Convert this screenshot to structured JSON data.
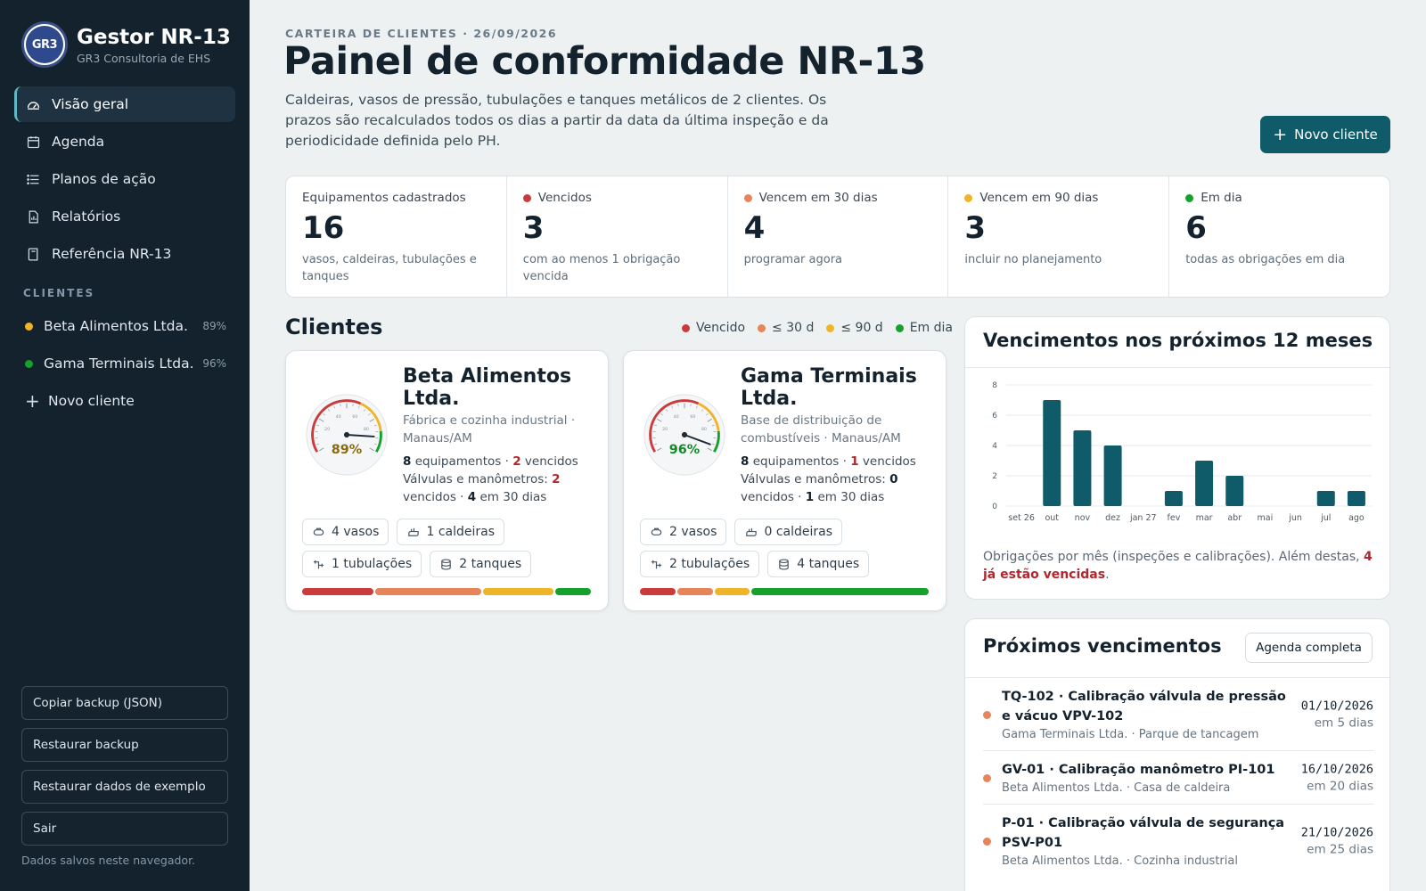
{
  "brand": {
    "title": "Gestor NR-13",
    "subtitle": "GR3 Consultoria de EHS",
    "logo_text": "GR3"
  },
  "nav": [
    {
      "label": "Visão geral",
      "icon": "gauge-icon",
      "active": true
    },
    {
      "label": "Agenda",
      "icon": "calendar-icon"
    },
    {
      "label": "Planos de ação",
      "icon": "list-icon"
    },
    {
      "label": "Relatórios",
      "icon": "report-icon"
    },
    {
      "label": "Referência NR-13",
      "icon": "book-icon"
    }
  ],
  "clients_section_label": "CLIENTES",
  "sidebar_clients": [
    {
      "name": "Beta Alimentos Ltda.",
      "pct": "89%",
      "color": "#f0b429"
    },
    {
      "name": "Gama Terminais Ltda.",
      "pct": "96%",
      "color": "#16a02c"
    }
  ],
  "sidebar_new_client": "Novo cliente",
  "sidebar_buttons": {
    "copy": "Copiar backup (JSON)",
    "restore": "Restaurar backup",
    "sample": "Restaurar dados de exemplo",
    "logout": "Sair"
  },
  "sidebar_note": "Dados salvos neste navegador.",
  "header": {
    "kicker": "CARTEIRA DE CLIENTES · 26/09/2026",
    "title": "Painel de conformidade NR-13",
    "description": "Caldeiras, vasos de pressão, tubulações e tanques metálicos de 2 clientes. Os prazos são recalculados todos os dias a partir da data da última inspeção e da periodicidade definida pelo PH.",
    "new_client_button": "Novo cliente"
  },
  "stats": [
    {
      "label": "Equipamentos cadastrados",
      "value": "16",
      "sub": "vasos, caldeiras, tubulações e tanques",
      "color": ""
    },
    {
      "label": "Vencidos",
      "value": "3",
      "sub": "com ao menos 1 obrigação vencida",
      "color": "#cc3b3b"
    },
    {
      "label": "Vencem em 30 dias",
      "value": "4",
      "sub": "programar agora",
      "color": "#e8845a"
    },
    {
      "label": "Vencem em 90 dias",
      "value": "3",
      "sub": "incluir no planejamento",
      "color": "#f0b429"
    },
    {
      "label": "Em dia",
      "value": "6",
      "sub": "todas as obrigações em dia",
      "color": "#16a02c"
    }
  ],
  "clients_title": "Clientes",
  "legend": [
    {
      "label": "Vencido",
      "color": "#cc3b3b"
    },
    {
      "label": "≤ 30 d",
      "color": "#e8845a"
    },
    {
      "label": "≤ 90 d",
      "color": "#f0b429"
    },
    {
      "label": "Em dia",
      "color": "#16a02c"
    }
  ],
  "client_cards": [
    {
      "name": "Beta Alimentos Ltda.",
      "desc": "Fábrica e cozinha industrial · Manaus/AM",
      "score": 89,
      "score_label": "89%",
      "score_color": "#8a6a10",
      "equip_count": "8",
      "equip_text": "equipamentos ·",
      "overdue_count": "2",
      "overdue_text": "vencidos",
      "valves_text": "Válvulas e manômetros:",
      "valves_overdue": "2",
      "valves_overdue_text": "vencidos ·",
      "valves_30": "4",
      "valves_30_text": "em 30 dias",
      "chips": [
        "4 vasos",
        "1 caldeiras",
        "1 tubulações",
        "2 tanques"
      ],
      "bar": [
        2,
        3,
        2,
        1
      ]
    },
    {
      "name": "Gama Terminais Ltda.",
      "desc": "Base de distribuição de combustíveis · Manaus/AM",
      "score": 96,
      "score_label": "96%",
      "score_color": "#138a27",
      "equip_count": "8",
      "equip_text": "equipamentos ·",
      "overdue_count": "1",
      "overdue_text": "vencidos",
      "valves_text": "Válvulas e manômetros:",
      "valves_overdue": "0",
      "valves_overdue_text": "vencidos ·",
      "valves_30": "1",
      "valves_30_text": "em 30 dias",
      "chips": [
        "2 vasos",
        "0 caldeiras",
        "2 tubulações",
        "4 tanques"
      ],
      "bar": [
        1,
        1,
        1,
        5
      ]
    }
  ],
  "chart_title": "Vencimentos nos próximos 12 meses",
  "chart_data": {
    "type": "bar",
    "categories": [
      "set 26",
      "out",
      "nov",
      "dez",
      "jan 27",
      "fev",
      "mar",
      "abr",
      "mai",
      "jun",
      "jul",
      "ago"
    ],
    "values": [
      0,
      7,
      5,
      4,
      0,
      1,
      3,
      2,
      0,
      0,
      1,
      1
    ],
    "ylim": [
      0,
      8
    ],
    "yticks": [
      0,
      2,
      4,
      6,
      8
    ],
    "grid": true,
    "color": "#0f5b6a"
  },
  "chart_note": {
    "text": "Obrigações por mês (inspeções e calibrações). Além destas,",
    "highlight": "4 já estão vencidas",
    "end": "."
  },
  "next_title": "Próximos vencimentos",
  "next_button": "Agenda completa",
  "next_items": [
    {
      "title": "TQ-102 · Calibração válvula de pressão e vácuo VPV-102",
      "sub": "Gama Terminais Ltda. · Parque de tancagem",
      "date": "01/10/2026",
      "rel": "em 5 dias",
      "color": "#e8845a"
    },
    {
      "title": "GV-01 · Calibração manômetro PI-101",
      "sub": "Beta Alimentos Ltda. · Casa de caldeira",
      "date": "16/10/2026",
      "rel": "em 20 dias",
      "color": "#e8845a"
    },
    {
      "title": "P-01 · Calibração válvula de segurança PSV-P01",
      "sub": "Beta Alimentos Ltda. · Cozinha industrial",
      "date": "21/10/2026",
      "rel": "em 25 dias",
      "color": "#e8845a"
    }
  ],
  "colors": {
    "overdue": "#cc3b3b",
    "d30": "#e8845a",
    "d90": "#f0b429",
    "ok": "#16a02c",
    "accent": "#0f5b6a",
    "sidebar": "#14222e"
  }
}
